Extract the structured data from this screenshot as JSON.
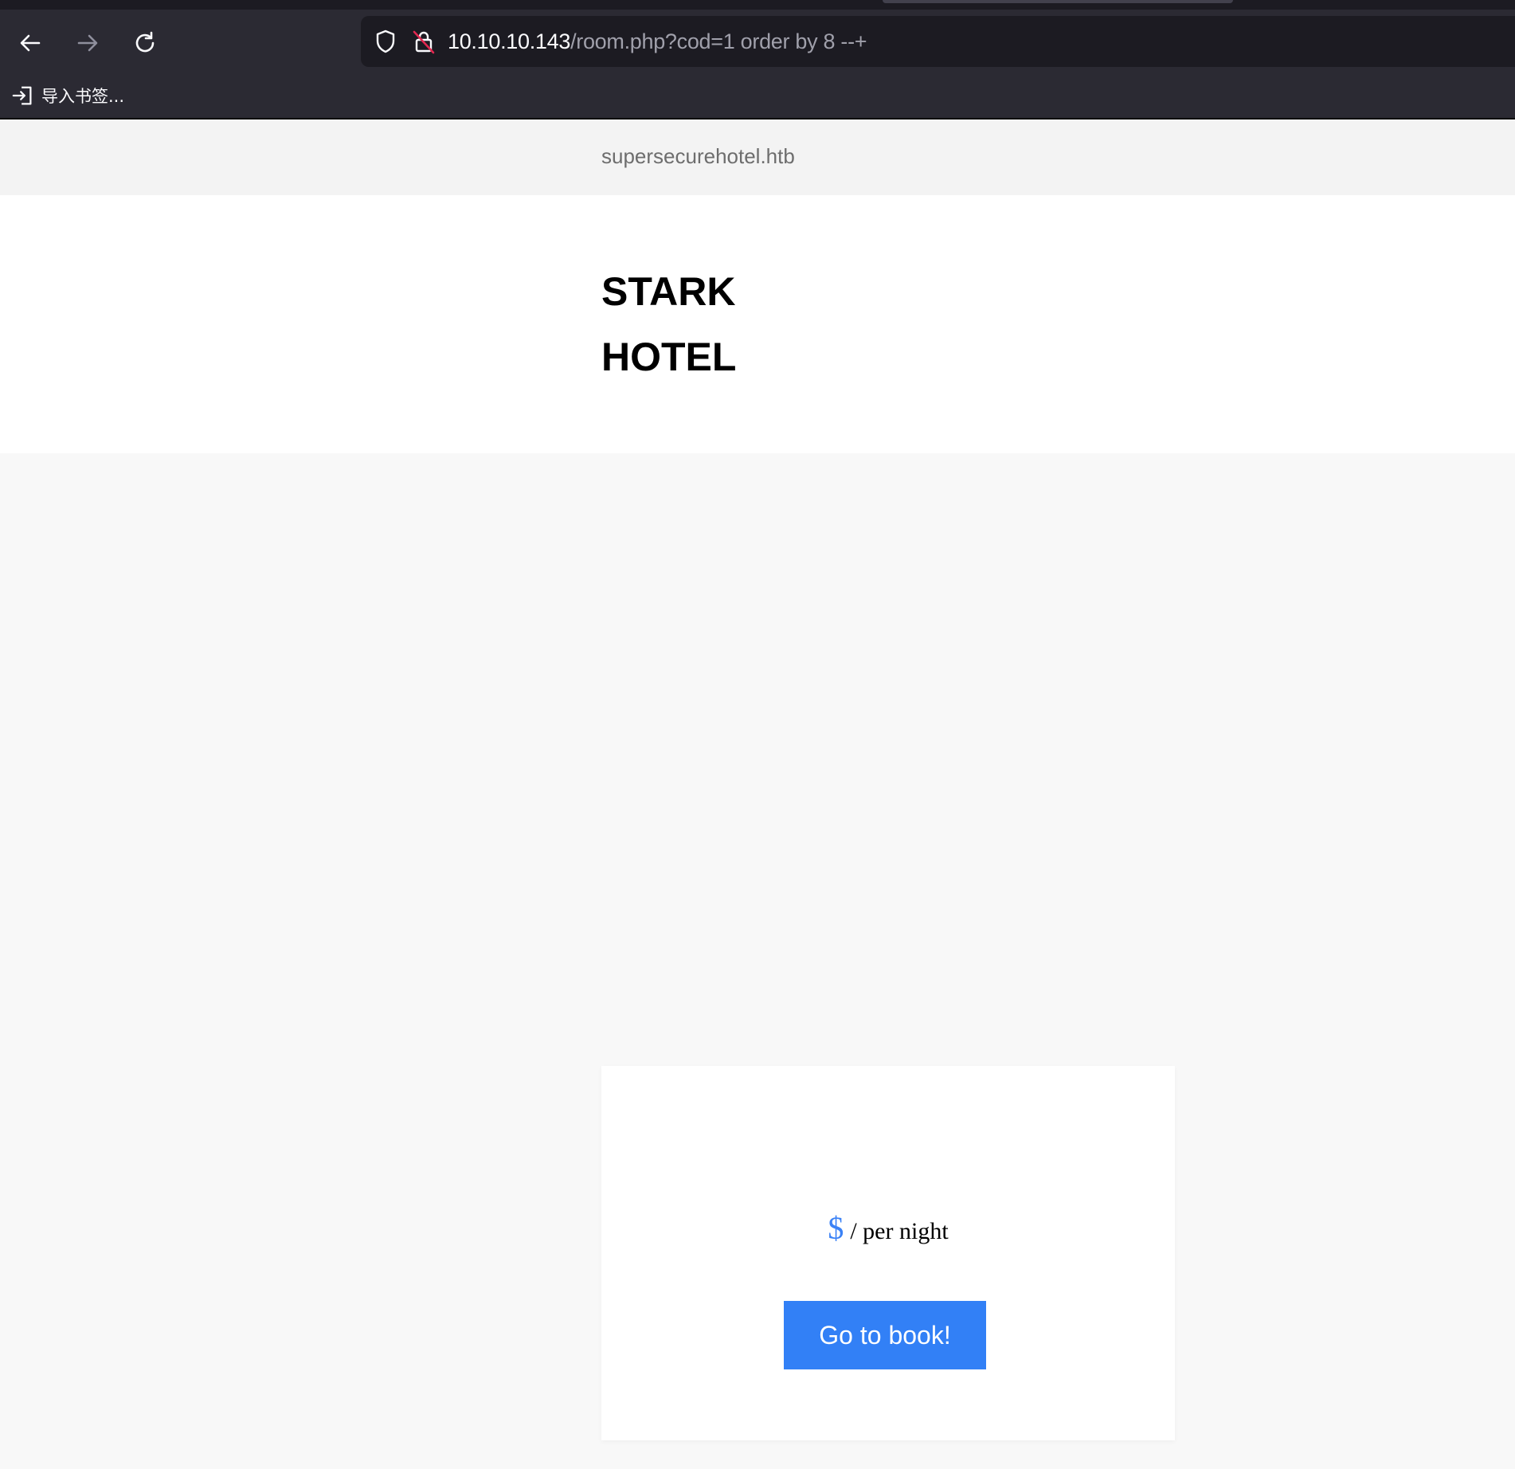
{
  "browser": {
    "url_host": "10.10.10.143",
    "url_path": "/room.php?cod=1 order by 8 --+",
    "bookmarks_import_label": "导入书签..."
  },
  "site": {
    "name": "supersecurehotel.htb",
    "hero_line1": "STARK",
    "hero_line2": "HOTEL"
  },
  "room_card": {
    "currency_symbol": "$",
    "price_suffix": "/ per night",
    "book_button_label": "Go to book!"
  },
  "colors": {
    "chrome_bg": "#2b2a33",
    "urlbar_bg": "#1c1b22",
    "accent_blue": "#3280f6",
    "insecure_red": "#e22850"
  },
  "icons": {
    "back": "arrow-left-icon",
    "forward": "arrow-right-icon",
    "reload": "reload-icon",
    "tracking_protection": "shield-icon",
    "insecure_connection": "lock-insecure-icon",
    "import_bookmarks": "import-icon"
  }
}
